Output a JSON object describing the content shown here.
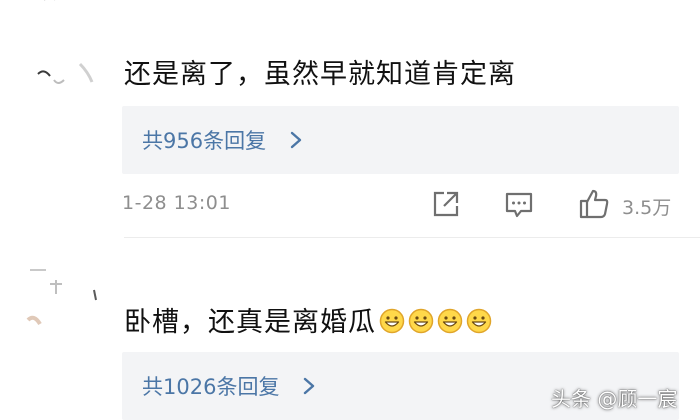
{
  "comments": [
    {
      "text": "还是离了，虽然早就知道肯定离",
      "reply_label": "共956条回复",
      "time": "1-28  13:01",
      "likes": "3.5万"
    },
    {
      "text": "卧槽，还真是离婚瓜",
      "emoji_count": 4,
      "reply_label": "共1026条回复"
    }
  ],
  "watermark": "头条 @顾一宸",
  "icons": {
    "share": "share-icon",
    "comment": "comment-icon",
    "like": "thumbs-up-icon",
    "reply_arrow": "chevron-right-icon",
    "emoji": "grinning-face-icon"
  },
  "colors": {
    "reply_link": "#4b76a6",
    "reply_bg": "#f3f4f6",
    "meta_gray": "#8e8e8e"
  }
}
